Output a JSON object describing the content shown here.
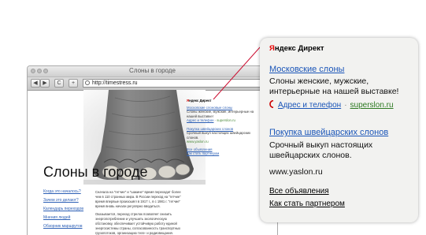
{
  "browser": {
    "window_title": "Слоны в городе",
    "back_label": "◀",
    "forward_label": "▶",
    "reload_label": "C",
    "add_label": "+",
    "address": "http://timestress.ru"
  },
  "page": {
    "title": "Слоны в городе",
    "nav": [
      "Когда это началось?",
      "Зачем это делают?",
      "Календарь переходов",
      "Мнения людей",
      "Обзорник маршрутов"
    ],
    "paragraphs": [
      "Сначала на \"гетчие\" и \"шакине\" время переходит более чем в 110 странных мира. В России переход на \"гетчие\" время впервые произошёл в 1917 г., в с 1981 г. \"гетчие\" время вновь начали регулярно вводиться.",
      "Оказывается, переход стрелок позволяет снизить энергопотребление и улучшить экологическую обстановку, обеспечивает устойчивую работу единой энергосистемы страны, согласованность транспортных грузопотоков, организацию теле- и радиовещания."
    ],
    "mini_ad": {
      "brand_y": "Я",
      "brand_rest": "ндекс Директ",
      "ad1_title": "Московские слоновые слоны",
      "ad1_text": "Слоны женские, мужские, интерьерные на нашей выставке!",
      "ad1_contacts": "Адрес и телефон",
      "ad1_url": "superslon.ru",
      "ad2_title": "Покупка швейцарских слонов",
      "ad2_text": "Срочный выкуп настоящих швейцарских слонов.",
      "ad2_url": "www.yaslon.ru",
      "all_ads": "Все объявления",
      "become_partner": "Как стать партнером"
    }
  },
  "callout": {
    "brand_y": "Я",
    "brand_rest": "ндекс ",
    "brand_direct": "Директ",
    "ad1": {
      "title": "Московские слоны",
      "text": "Слоны женские, мужские, интерьерные на нашей выставке!",
      "contact_label": "Адрес и телефон",
      "separator": "·",
      "url": "superslon.ru"
    },
    "ad2": {
      "title": "Покупка швейцарских слонов",
      "text": "Срочный выкуп настоящих швейцарских слонов.",
      "url": "www.yaslon.ru"
    },
    "all_ads_label": "Все объявления",
    "partner_label": "Как стать партнером"
  },
  "colors": {
    "link": "#1a55b8",
    "green_url": "#2d7a22",
    "callout_line": "#cc1133",
    "brand_red": "#e60000"
  }
}
